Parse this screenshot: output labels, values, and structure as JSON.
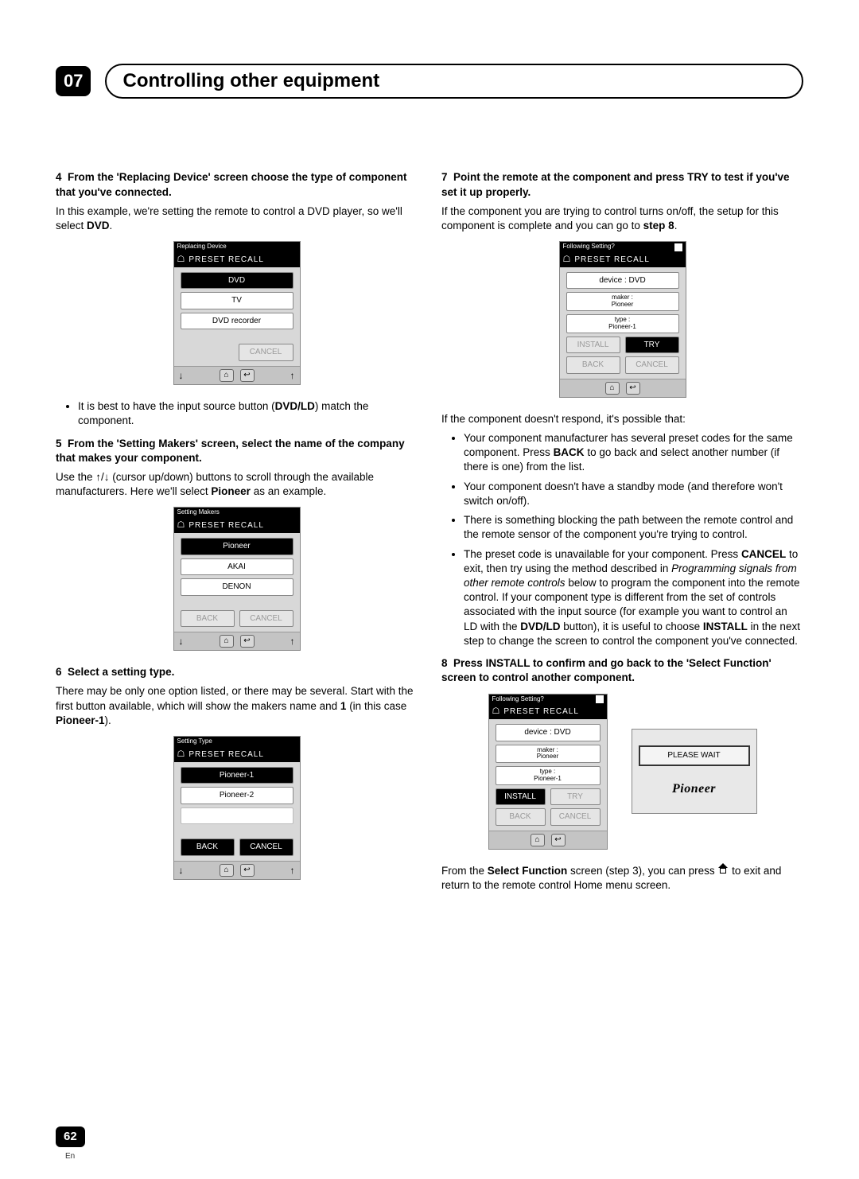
{
  "header": {
    "chapter_num": "07",
    "chapter_title": "Controlling other equipment"
  },
  "left": {
    "step4": {
      "num": "4",
      "head": "From the 'Replacing Device' screen choose the type of component that you've connected.",
      "body1": "In this example, we're setting the remote to control a DVD player, so we'll select ",
      "body_bold1": "DVD",
      "body2": "."
    },
    "fig1": {
      "title": "Replacing Device",
      "header": "PRESET RECALL",
      "items": [
        "DVD",
        "TV",
        "DVD recorder"
      ],
      "cancel": "CANCEL"
    },
    "bullet1a": "It is best to have the input source button (",
    "bullet1b": "DVD/LD",
    "bullet1c": ") match the component.",
    "step5": {
      "num": "5",
      "head": "From the 'Setting Makers' screen, select the name of the company that makes your component.",
      "body_a": "Use the ",
      "body_b": " (cursor up/down) buttons to scroll through the available manufacturers. Here we'll select ",
      "body_bold": "Pioneer",
      "body_c": " as an example."
    },
    "fig2": {
      "title": "Setting Makers",
      "header": "PRESET RECALL",
      "items": [
        "Pioneer",
        "AKAI",
        "DENON"
      ],
      "back": "BACK",
      "cancel": "CANCEL"
    },
    "step6": {
      "num": "6",
      "head": "Select a setting type.",
      "body_a": "There may be only one option listed, or there may be several. Start with the first button available, which will show the makers name and ",
      "body_bold1": "1",
      "body_b": " (in this case ",
      "body_bold2": "Pioneer-1",
      "body_c": ")."
    },
    "fig3": {
      "title": "Setting Type",
      "header": "PRESET RECALL",
      "items": [
        "Pioneer-1",
        "Pioneer-2"
      ],
      "back": "BACK",
      "cancel": "CANCEL"
    }
  },
  "right": {
    "step7": {
      "num": "7",
      "head": "Point the remote at the component and press TRY to test if you've set it up properly.",
      "body_a": "If the component you are trying to control turns on/off, the setup for this component is complete and you can go to ",
      "body_bold": "step 8",
      "body_b": "."
    },
    "fig4": {
      "title": "Following Setting?",
      "header": "PRESET RECALL",
      "lines": [
        "device : DVD",
        "maker :\nPioneer",
        "type :\nPioneer-1"
      ],
      "install": "INSTALL",
      "try": "TRY",
      "back": "BACK",
      "cancel": "CANCEL"
    },
    "norespond_intro": "If the component doesn't respond, it's possible that:",
    "bullets": {
      "b1a": "Your component manufacturer has several preset codes for the same component. Press ",
      "b1b": "BACK",
      "b1c": " to go back and select another number (if there is one) from the list.",
      "b2": "Your component doesn't have a standby mode (and therefore won't switch on/off).",
      "b3": "There is something blocking the path between the remote control and the remote sensor of the component you're trying to control.",
      "b4a": "The preset code is unavailable for your component. Press ",
      "b4b": "CANCEL",
      "b4c": " to exit, then try using the method described in ",
      "b4d": "Programming signals from other remote controls",
      "b4e": " below to program the component into the remote control. If your component type is different from the set of controls associated with the input source (for example you want to control an LD with the ",
      "b4f": "DVD/LD",
      "b4g": " button), it is useful to choose ",
      "b4h": "INSTALL",
      "b4i": " in the next step to change the screen to control the component you've connected."
    },
    "step8": {
      "num": "8",
      "head": "Press INSTALL to confirm and go back to the 'Select Function' screen to control another component."
    },
    "wait": {
      "label": "PLEASE WAIT",
      "logo": "Pioneer"
    },
    "tail_a": "From the ",
    "tail_b": "Select Function",
    "tail_c": " screen (step 3), you can press ",
    "tail_d": " to exit and return to the remote control Home menu screen."
  },
  "footer": {
    "page": "62",
    "lang": "En"
  }
}
